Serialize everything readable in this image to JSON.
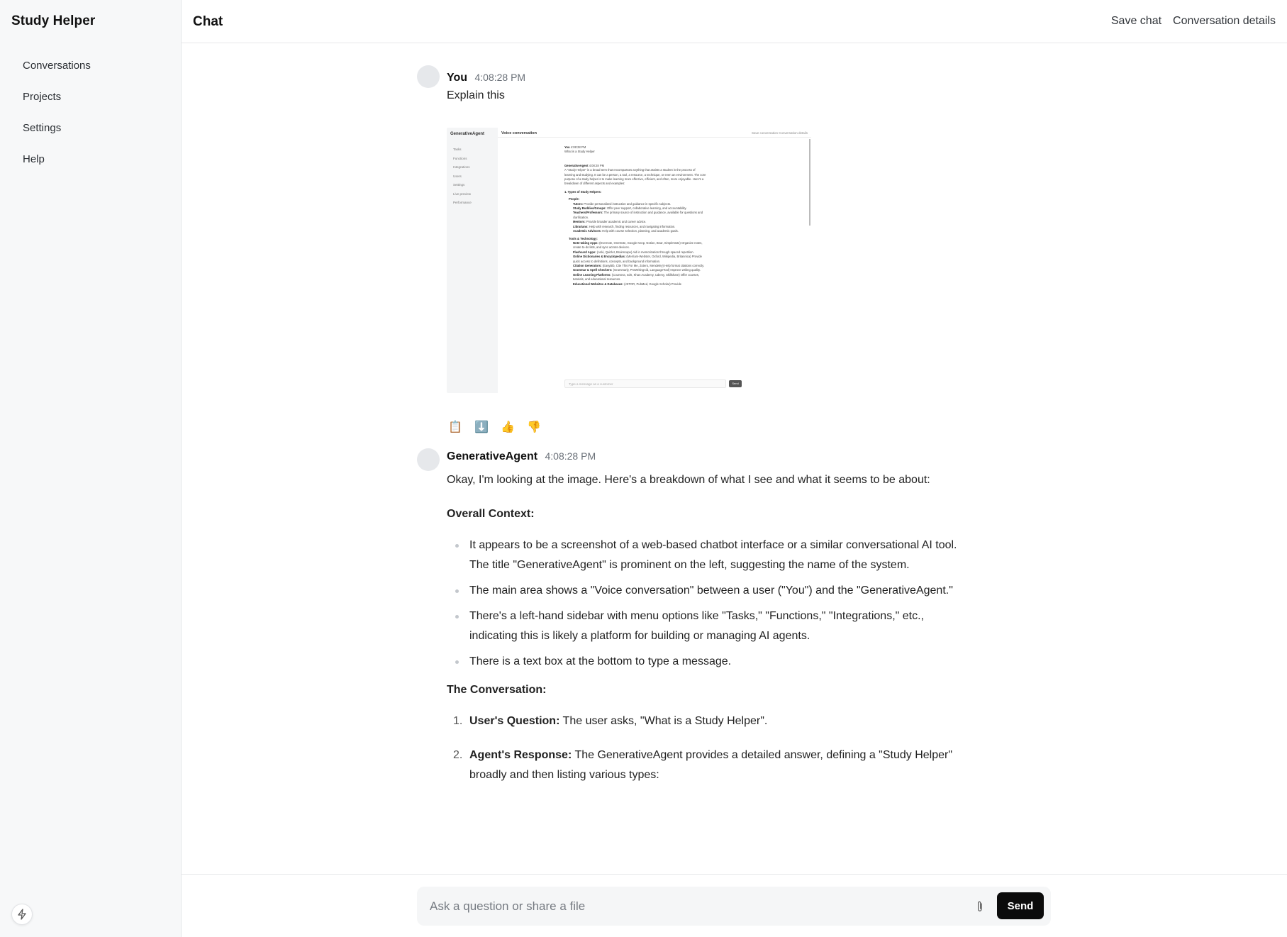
{
  "app": {
    "title": "Study Helper"
  },
  "sidebar": {
    "items": [
      {
        "label": "Conversations"
      },
      {
        "label": "Projects"
      },
      {
        "label": "Settings"
      },
      {
        "label": "Help"
      }
    ],
    "footer_icon": "bolt-icon"
  },
  "header": {
    "title": "Chat",
    "save_label": "Save chat",
    "details_label": "Conversation details"
  },
  "messages": {
    "user": {
      "author": "You",
      "time": "4:08:28 PM",
      "text": "Explain this"
    },
    "attachment": {
      "brand": "GenerativeAgent",
      "nav": [
        "Tasks",
        "Functions",
        "Integrations",
        "Users",
        "Settings",
        "Live preview",
        "Performance"
      ],
      "title": "Voice conversation",
      "actions": "Save conversation   Conversation details",
      "user_author": "You",
      "user_time": "4:08:28 PM",
      "user_text": "What is a Study Helper",
      "agent_author": "GenerativeAgent",
      "agent_time": "4:08:28 PM",
      "agent_intro": "A \"Study Helper\" is a broad term that encompasses anything that assists a student in the process of learning and studying. It can be a person, a tool, a resource, a technique, or even an environment. The core purpose of a study helper is to make learning more effective, efficient, and often, more enjoyable. Here's a breakdown of different aspects and examples:",
      "types_heading": "1. Types of Study Helpers:",
      "people_label": "People:",
      "people": [
        {
          "b": "Tutors:",
          "t": "Provide personalized instruction and guidance in specific subjects."
        },
        {
          "b": "Study Buddies/Groups:",
          "t": "Offer peer support, collaborative learning, and accountability."
        },
        {
          "b": "Teachers/Professors:",
          "t": "The primary source of instruction and guidance, available for questions and clarification."
        },
        {
          "b": "Mentors:",
          "t": "Provide broader academic and career advice."
        },
        {
          "b": "Librarians:",
          "t": "Help with research, finding resources, and navigating information."
        },
        {
          "b": "Academic Advisors:",
          "t": "Help with course selection, planning, and academic goals."
        }
      ],
      "tools_label": "Tools & Technology:",
      "tools": [
        {
          "b": "Note-taking Apps:",
          "t": "(Evernote, OneNote, Google Keep, Notion, Bear, SimpleNote) Organize notes, create to-do lists, and sync across devices."
        },
        {
          "b": "Flashcard Apps:",
          "t": "(Anki, Quizlet, Brainscape) Aid in memorization through spaced repetition."
        },
        {
          "b": "Online Dictionaries & Encyclopedias:",
          "t": "(Merriam-Webster, Oxford, Wikipedia, Britannica) Provide quick access to definitions, concepts, and background information."
        },
        {
          "b": "Citation Generators:",
          "t": "(EasyBib, Cite This For Me, Zotero, Mendeley) Help format citations correctly."
        },
        {
          "b": "Grammar & Spell Checkers:",
          "t": "(Grammarly, ProWritingAid, LanguageTool) Improve writing quality."
        },
        {
          "b": "Online Learning Platforms:",
          "t": "(Coursera, edX, Khan Academy, Udemy, Skillshare) Offer courses, tutorials, and educational resources."
        },
        {
          "b": "Educational Websites & Databases:",
          "t": "(JSTOR, PubMed, Google Scholar) Provide"
        }
      ],
      "input_placeholder": "Type a message as a customer",
      "send_label": "Send"
    },
    "tools": [
      {
        "icon": "clipboard-icon",
        "glyph": "📋"
      },
      {
        "icon": "download-icon",
        "glyph": "⬇️"
      },
      {
        "icon": "thumbs-up-icon",
        "glyph": "👍"
      },
      {
        "icon": "thumbs-down-icon",
        "glyph": "👎"
      }
    ],
    "agent": {
      "author": "GenerativeAgent",
      "time": "4:08:28 PM",
      "intro": "Okay, I'm looking at the image. Here's a breakdown of what I see and what it seems to be about:",
      "context_heading": "Overall Context:",
      "context_bullets": [
        "It appears to be a screenshot of a web-based chatbot interface or a similar conversational AI tool. The title \"GenerativeAgent\" is prominent on the left, suggesting the name of the system.",
        "The main area shows a \"Voice conversation\" between a user (\"You\") and the \"GenerativeAgent.\"",
        "There's a left-hand sidebar with menu options like \"Tasks,\" \"Functions,\" \"Integrations,\" etc., indicating this is likely a platform for building or managing AI agents.",
        "There is a text box at the bottom to type a message."
      ],
      "conversation_heading": "The Conversation:",
      "conversation_items": [
        {
          "num": "1.",
          "bold": "User's Question:",
          "text": " The user asks, \"What is a Study Helper\"."
        },
        {
          "num": "2.",
          "bold": "Agent's Response:",
          "text": " The GenerativeAgent provides a detailed answer, defining a \"Study Helper\" broadly and then listing various types:"
        }
      ]
    }
  },
  "composer": {
    "placeholder": "Ask a question or share a file",
    "attach_icon": "paperclip-icon",
    "send_label": "Send"
  }
}
